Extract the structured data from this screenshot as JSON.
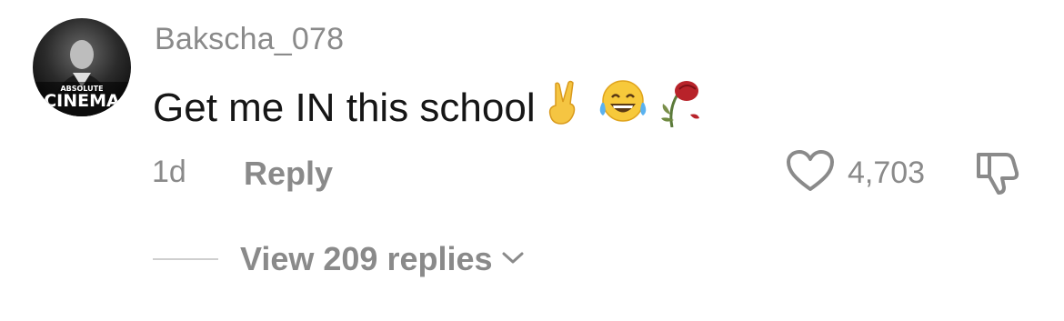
{
  "comment": {
    "username": "Bakscha_078",
    "avatar_text_top": "ABSOLUTE",
    "avatar_text_main": "CINEMA",
    "text": "Get me IN this school",
    "emojis": [
      "victory-hand-emoji",
      "tears-of-joy-emoji",
      "wilted-flower-emoji"
    ],
    "time": "1d",
    "reply_label": "Reply",
    "like_count": "4,703",
    "view_replies_label": "View 209 replies"
  },
  "icons": {
    "like": "heart-outline-icon",
    "dislike": "thumbs-down-outline-icon",
    "expand": "chevron-down-icon"
  },
  "colors": {
    "username": "#8a8a8a",
    "text": "#161616",
    "meta": "#8a8a8a"
  }
}
